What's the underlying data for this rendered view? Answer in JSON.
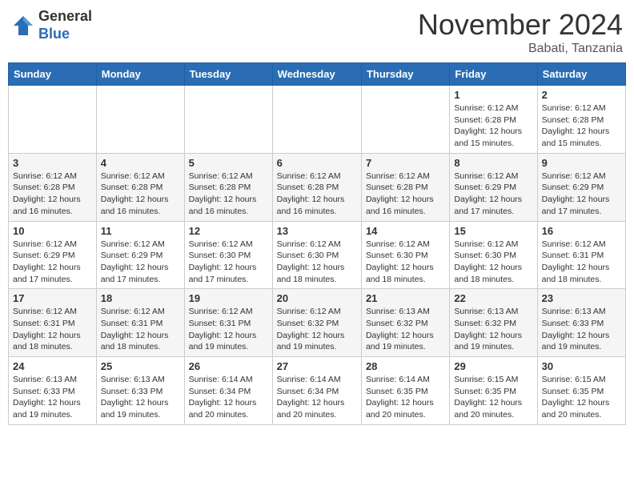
{
  "header": {
    "logo_general": "General",
    "logo_blue": "Blue",
    "month_title": "November 2024",
    "location": "Babati, Tanzania"
  },
  "weekdays": [
    "Sunday",
    "Monday",
    "Tuesday",
    "Wednesday",
    "Thursday",
    "Friday",
    "Saturday"
  ],
  "weeks": [
    [
      {
        "day": "",
        "info": ""
      },
      {
        "day": "",
        "info": ""
      },
      {
        "day": "",
        "info": ""
      },
      {
        "day": "",
        "info": ""
      },
      {
        "day": "",
        "info": ""
      },
      {
        "day": "1",
        "info": "Sunrise: 6:12 AM\nSunset: 6:28 PM\nDaylight: 12 hours\nand 15 minutes."
      },
      {
        "day": "2",
        "info": "Sunrise: 6:12 AM\nSunset: 6:28 PM\nDaylight: 12 hours\nand 15 minutes."
      }
    ],
    [
      {
        "day": "3",
        "info": "Sunrise: 6:12 AM\nSunset: 6:28 PM\nDaylight: 12 hours\nand 16 minutes."
      },
      {
        "day": "4",
        "info": "Sunrise: 6:12 AM\nSunset: 6:28 PM\nDaylight: 12 hours\nand 16 minutes."
      },
      {
        "day": "5",
        "info": "Sunrise: 6:12 AM\nSunset: 6:28 PM\nDaylight: 12 hours\nand 16 minutes."
      },
      {
        "day": "6",
        "info": "Sunrise: 6:12 AM\nSunset: 6:28 PM\nDaylight: 12 hours\nand 16 minutes."
      },
      {
        "day": "7",
        "info": "Sunrise: 6:12 AM\nSunset: 6:28 PM\nDaylight: 12 hours\nand 16 minutes."
      },
      {
        "day": "8",
        "info": "Sunrise: 6:12 AM\nSunset: 6:29 PM\nDaylight: 12 hours\nand 17 minutes."
      },
      {
        "day": "9",
        "info": "Sunrise: 6:12 AM\nSunset: 6:29 PM\nDaylight: 12 hours\nand 17 minutes."
      }
    ],
    [
      {
        "day": "10",
        "info": "Sunrise: 6:12 AM\nSunset: 6:29 PM\nDaylight: 12 hours\nand 17 minutes."
      },
      {
        "day": "11",
        "info": "Sunrise: 6:12 AM\nSunset: 6:29 PM\nDaylight: 12 hours\nand 17 minutes."
      },
      {
        "day": "12",
        "info": "Sunrise: 6:12 AM\nSunset: 6:30 PM\nDaylight: 12 hours\nand 17 minutes."
      },
      {
        "day": "13",
        "info": "Sunrise: 6:12 AM\nSunset: 6:30 PM\nDaylight: 12 hours\nand 18 minutes."
      },
      {
        "day": "14",
        "info": "Sunrise: 6:12 AM\nSunset: 6:30 PM\nDaylight: 12 hours\nand 18 minutes."
      },
      {
        "day": "15",
        "info": "Sunrise: 6:12 AM\nSunset: 6:30 PM\nDaylight: 12 hours\nand 18 minutes."
      },
      {
        "day": "16",
        "info": "Sunrise: 6:12 AM\nSunset: 6:31 PM\nDaylight: 12 hours\nand 18 minutes."
      }
    ],
    [
      {
        "day": "17",
        "info": "Sunrise: 6:12 AM\nSunset: 6:31 PM\nDaylight: 12 hours\nand 18 minutes."
      },
      {
        "day": "18",
        "info": "Sunrise: 6:12 AM\nSunset: 6:31 PM\nDaylight: 12 hours\nand 18 minutes."
      },
      {
        "day": "19",
        "info": "Sunrise: 6:12 AM\nSunset: 6:31 PM\nDaylight: 12 hours\nand 19 minutes."
      },
      {
        "day": "20",
        "info": "Sunrise: 6:12 AM\nSunset: 6:32 PM\nDaylight: 12 hours\nand 19 minutes."
      },
      {
        "day": "21",
        "info": "Sunrise: 6:13 AM\nSunset: 6:32 PM\nDaylight: 12 hours\nand 19 minutes."
      },
      {
        "day": "22",
        "info": "Sunrise: 6:13 AM\nSunset: 6:32 PM\nDaylight: 12 hours\nand 19 minutes."
      },
      {
        "day": "23",
        "info": "Sunrise: 6:13 AM\nSunset: 6:33 PM\nDaylight: 12 hours\nand 19 minutes."
      }
    ],
    [
      {
        "day": "24",
        "info": "Sunrise: 6:13 AM\nSunset: 6:33 PM\nDaylight: 12 hours\nand 19 minutes."
      },
      {
        "day": "25",
        "info": "Sunrise: 6:13 AM\nSunset: 6:33 PM\nDaylight: 12 hours\nand 19 minutes."
      },
      {
        "day": "26",
        "info": "Sunrise: 6:14 AM\nSunset: 6:34 PM\nDaylight: 12 hours\nand 20 minutes."
      },
      {
        "day": "27",
        "info": "Sunrise: 6:14 AM\nSunset: 6:34 PM\nDaylight: 12 hours\nand 20 minutes."
      },
      {
        "day": "28",
        "info": "Sunrise: 6:14 AM\nSunset: 6:35 PM\nDaylight: 12 hours\nand 20 minutes."
      },
      {
        "day": "29",
        "info": "Sunrise: 6:15 AM\nSunset: 6:35 PM\nDaylight: 12 hours\nand 20 minutes."
      },
      {
        "day": "30",
        "info": "Sunrise: 6:15 AM\nSunset: 6:35 PM\nDaylight: 12 hours\nand 20 minutes."
      }
    ]
  ]
}
